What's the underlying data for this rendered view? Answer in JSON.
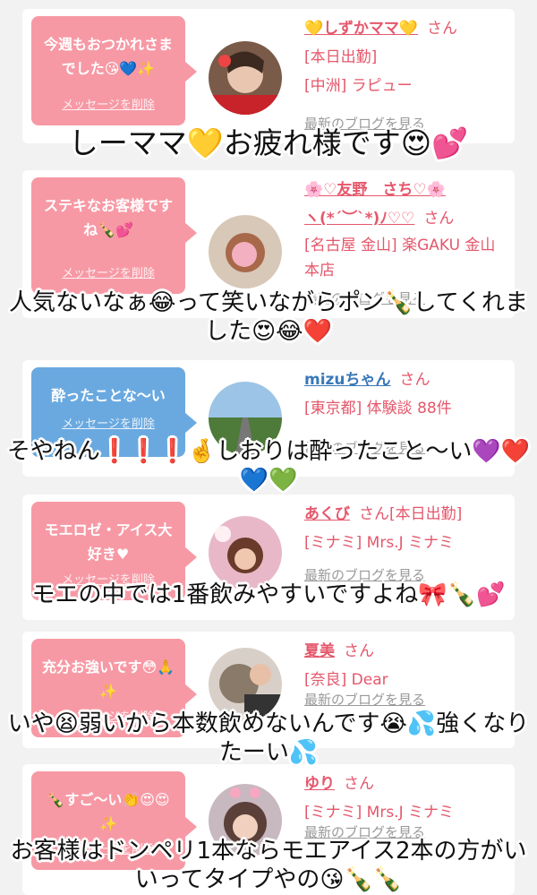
{
  "colors": {
    "pink": "#f799a5",
    "blue": "#6aa9e0",
    "name_pink": "#e5576b",
    "name_blue": "#3a78b8"
  },
  "cards": [
    {
      "message": "今週もおつかれさまでした😘💙✨",
      "delete": "メッセージを削除",
      "name": "💛しずかママ💛",
      "san": "さん",
      "meta": [
        "[本日出勤]",
        "[中洲] ラピュー"
      ],
      "blog": "最新のブログを見る",
      "caption": "しーママ💛お疲れ様です😍💕"
    },
    {
      "message": "ステキなお客様ですね🍾💕",
      "delete": "メッセージを削除",
      "name": "🌸♡友野　さち♡🌸",
      "name2": "ヽ(*´︶`*)ﾉ♡♡",
      "san": "さん",
      "meta": [
        "[名古屋 金山] 楽GAKU 金山本店"
      ],
      "blog": "最新のブログを見る",
      "caption": "人気ないなぁ😂って笑いながらポン🍾してくれました😍😂❤️"
    },
    {
      "message": "酔ったことな〜い",
      "delete": "メッセージを削除",
      "name": "mizuちゃん",
      "san": "さん",
      "meta": [
        "[東京都] 体験談 88件"
      ],
      "blog": "最新のブログを見る",
      "caption": "そやねん❗️❗️❗️🤞しおりは酔ったこと〜い💜❤️💙💚"
    },
    {
      "message": "モエロゼ・アイス大好き♥",
      "delete": "メッセージを削除",
      "name": "あくび",
      "san": "さん[本日出勤]",
      "meta": [
        "[ミナミ] Mrs.J ミナミ"
      ],
      "blog": "最新のブログを見る",
      "caption": "モエの中では1番飲みやすいですよね🎀🍾💕"
    },
    {
      "message": "充分お強いです😳🙏✨",
      "delete": "メッセージを削除",
      "name": "夏美",
      "san": "さん",
      "meta": [
        "[奈良] Dear"
      ],
      "blog": "最新のブログを見る",
      "caption": "いや😫弱いから本数飲めないんです😭💦強くなりたーい💦"
    },
    {
      "message": "🍾すご〜い👏😍😍✨",
      "delete": "メッセージを削除",
      "name": "ゆり",
      "san": "さん",
      "meta": [
        "[ミナミ] Mrs.J ミナミ"
      ],
      "blog": "最新のブログを見る",
      "caption": "お客様はドンペリ1本ならモエアイス2本の方がいいってタイプやの😘🍾🍾"
    }
  ]
}
